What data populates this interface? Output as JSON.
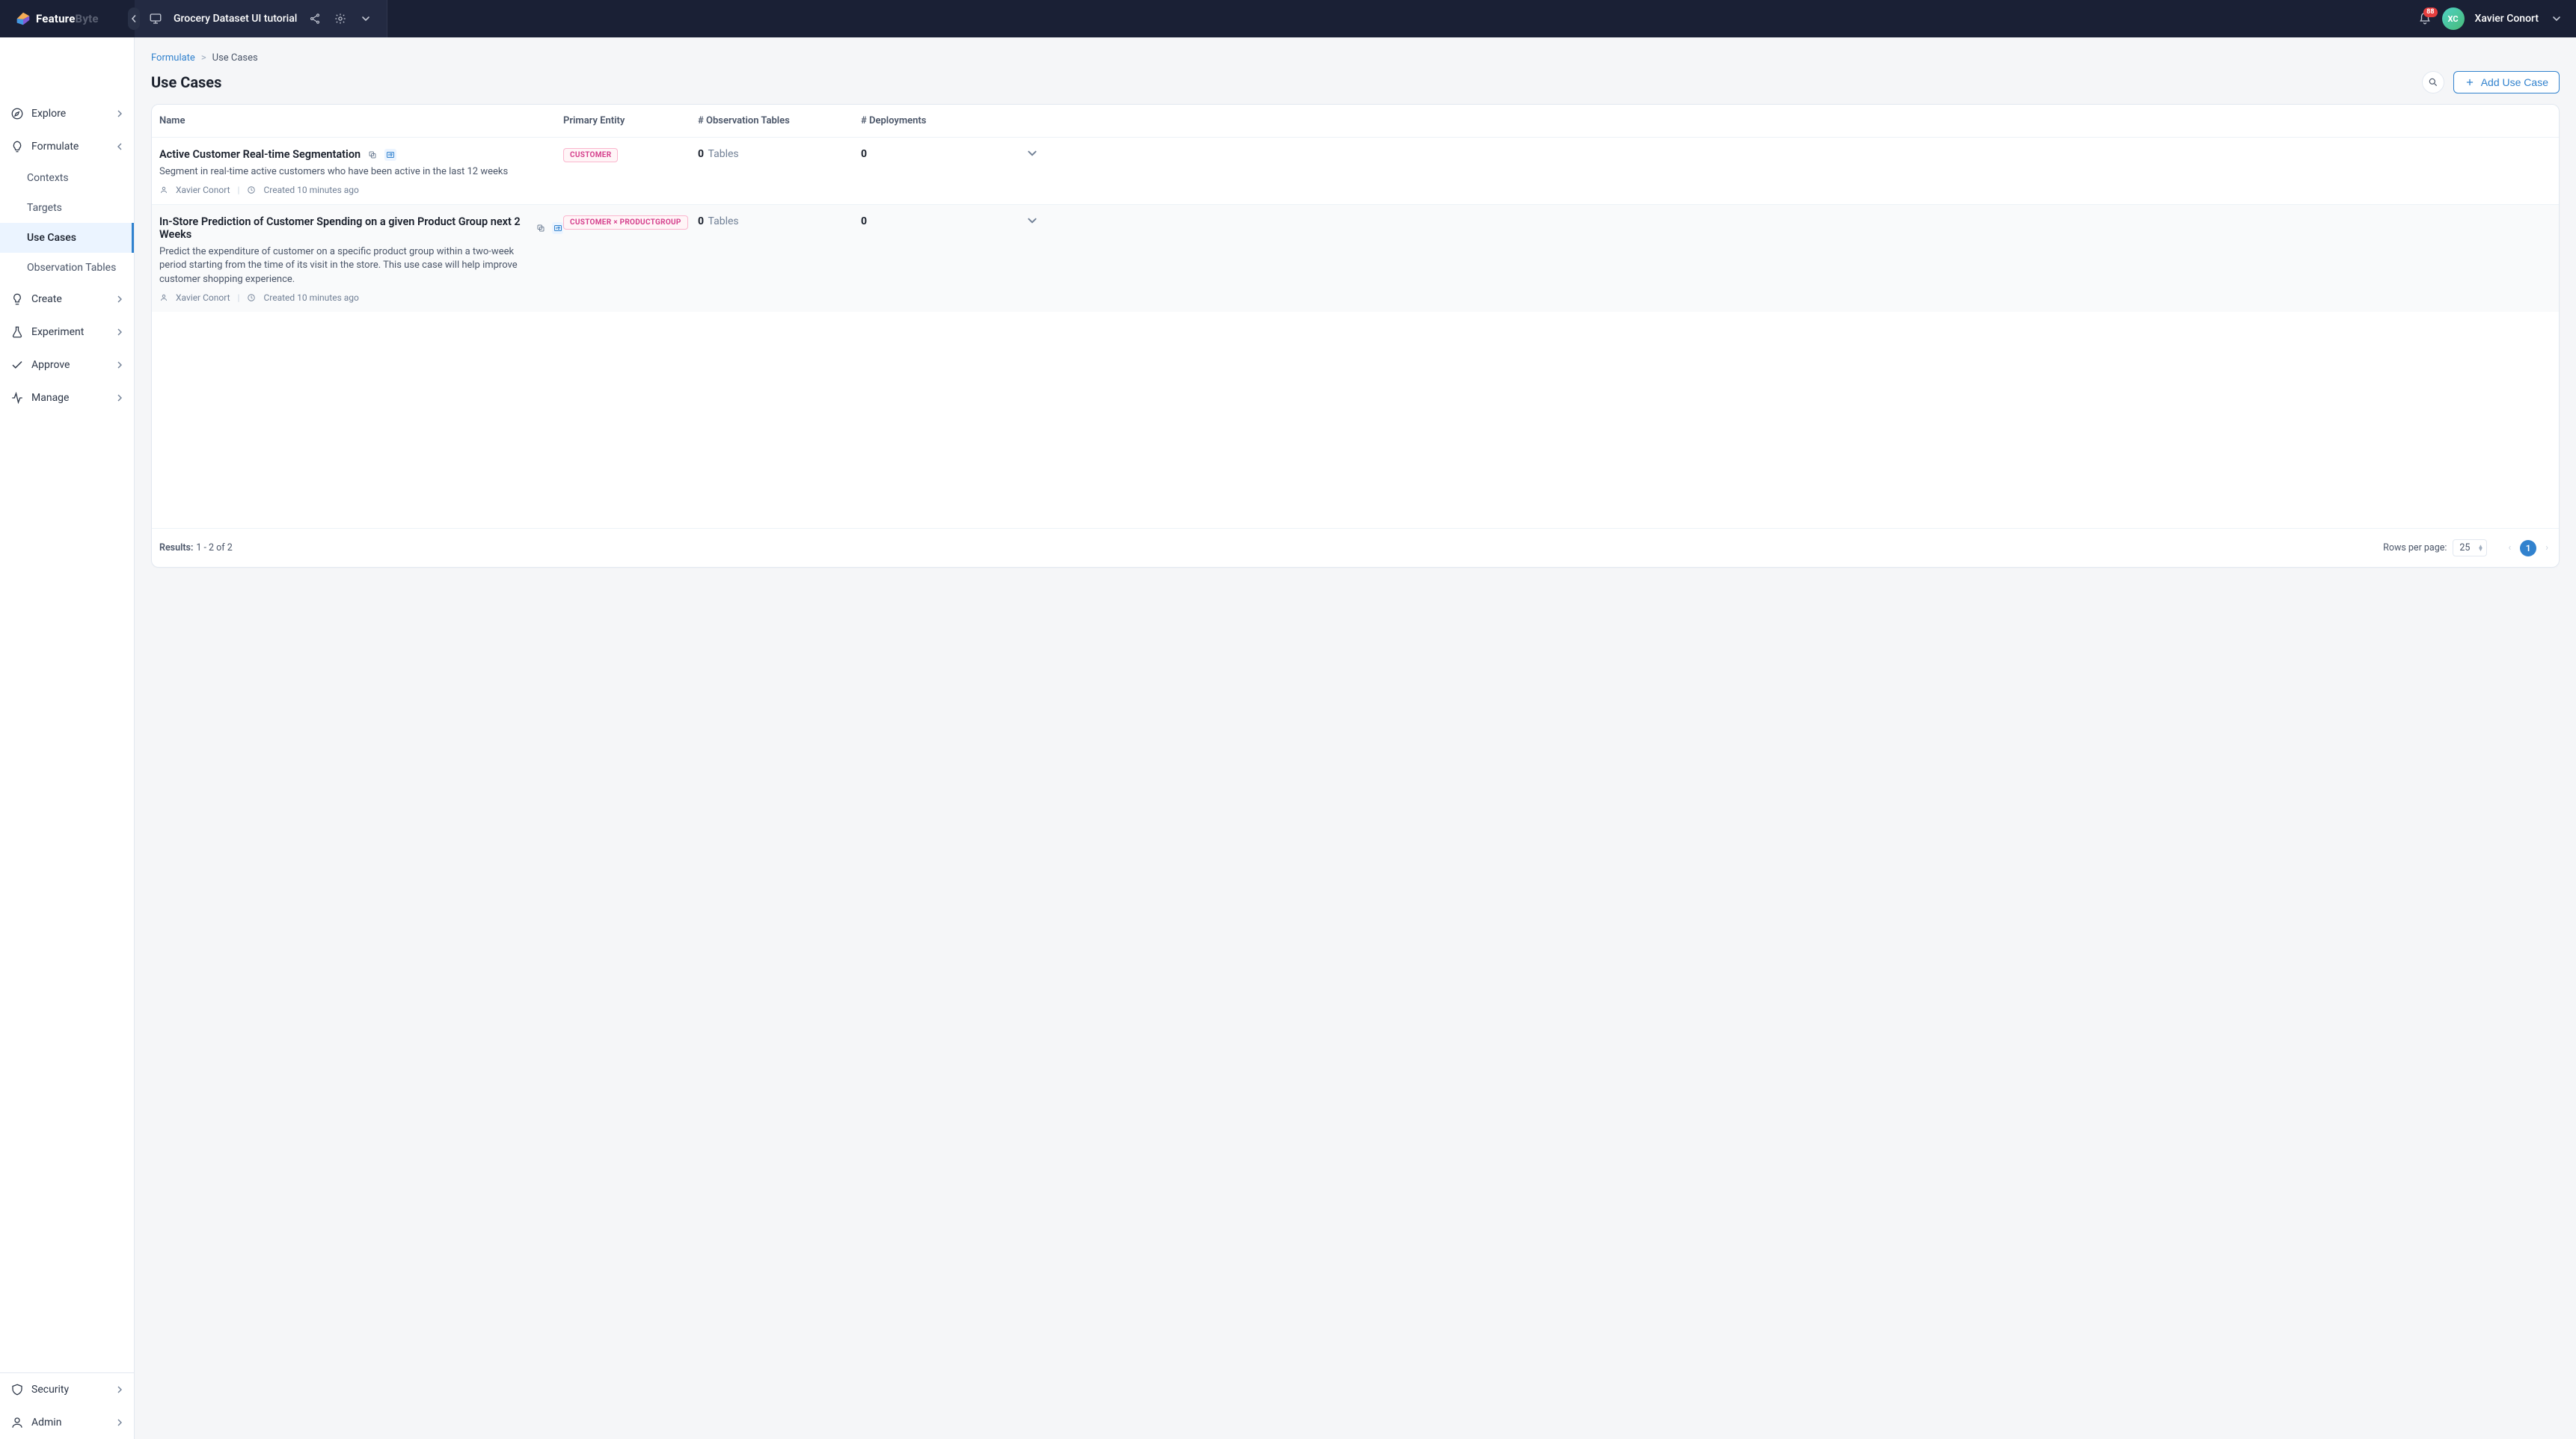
{
  "brand": {
    "name_bold": "Feature",
    "name_grey": "Byte"
  },
  "project_name": "Grocery Dataset UI tutorial",
  "notifications": {
    "count": "88"
  },
  "user": {
    "name": "Xavier Conort",
    "initials": "XC"
  },
  "sidebar": {
    "main": [
      {
        "label": "Explore"
      },
      {
        "label": "Formulate"
      },
      {
        "label": "Create"
      },
      {
        "label": "Experiment"
      },
      {
        "label": "Approve"
      },
      {
        "label": "Manage"
      }
    ],
    "formulate_sub": [
      {
        "label": "Contexts"
      },
      {
        "label": "Targets"
      },
      {
        "label": "Use Cases"
      },
      {
        "label": "Observation Tables"
      }
    ],
    "bottom": [
      {
        "label": "Security"
      },
      {
        "label": "Admin"
      }
    ]
  },
  "breadcrumbs": {
    "parent": "Formulate",
    "current": "Use Cases"
  },
  "page_title": "Use Cases",
  "add_button_label": "Add Use Case",
  "table": {
    "headers": {
      "name": "Name",
      "entity": "Primary Entity",
      "obs": "# Observation Tables",
      "dep": "# Deployments"
    },
    "rows": [
      {
        "title": "Active Customer Real-time Segmentation",
        "description": "Segment in real-time active customers who have been active in the last 12 weeks",
        "author": "Xavier Conort",
        "created": "Created 10 minutes ago",
        "entity": "CUSTOMER",
        "obs_count": "0",
        "obs_label": "Tables",
        "dep_count": "0"
      },
      {
        "title": "In-Store Prediction of Customer Spending on a given Product Group next 2 Weeks",
        "description": "Predict the expenditure of customer on a specific product group within a two-week period starting from the time of its visit in the store. This use case will help improve customer shopping experience.",
        "author": "Xavier Conort",
        "created": "Created 10 minutes ago",
        "entity": "CUSTOMER × PRODUCTGROUP",
        "obs_count": "0",
        "obs_label": "Tables",
        "dep_count": "0"
      }
    ]
  },
  "footer": {
    "results_label": "Results:",
    "results_value": "1 - 2 of 2",
    "rpp_label": "Rows per page:",
    "rpp_value": "25",
    "page": "1"
  }
}
